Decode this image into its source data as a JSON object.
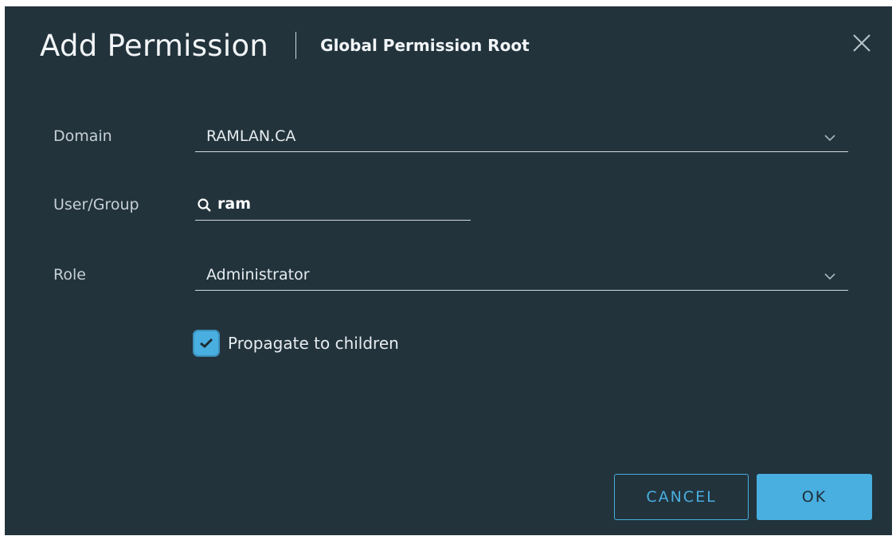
{
  "dialog": {
    "title": "Add Permission",
    "subtitle": "Global Permission Root",
    "close_icon": "close-icon"
  },
  "form": {
    "domain": {
      "label": "Domain",
      "value": "RAMLAN.CA"
    },
    "user_group": {
      "label": "User/Group",
      "value": "ram",
      "icon": "search-icon"
    },
    "role": {
      "label": "Role",
      "value": "Administrator"
    },
    "propagate": {
      "label": "Propagate to children",
      "checked": true
    }
  },
  "buttons": {
    "cancel_label": "CANCEL",
    "ok_label": "OK"
  },
  "colors": {
    "background": "#22333c",
    "accent": "#49aee0",
    "text": "#e6ecef"
  }
}
